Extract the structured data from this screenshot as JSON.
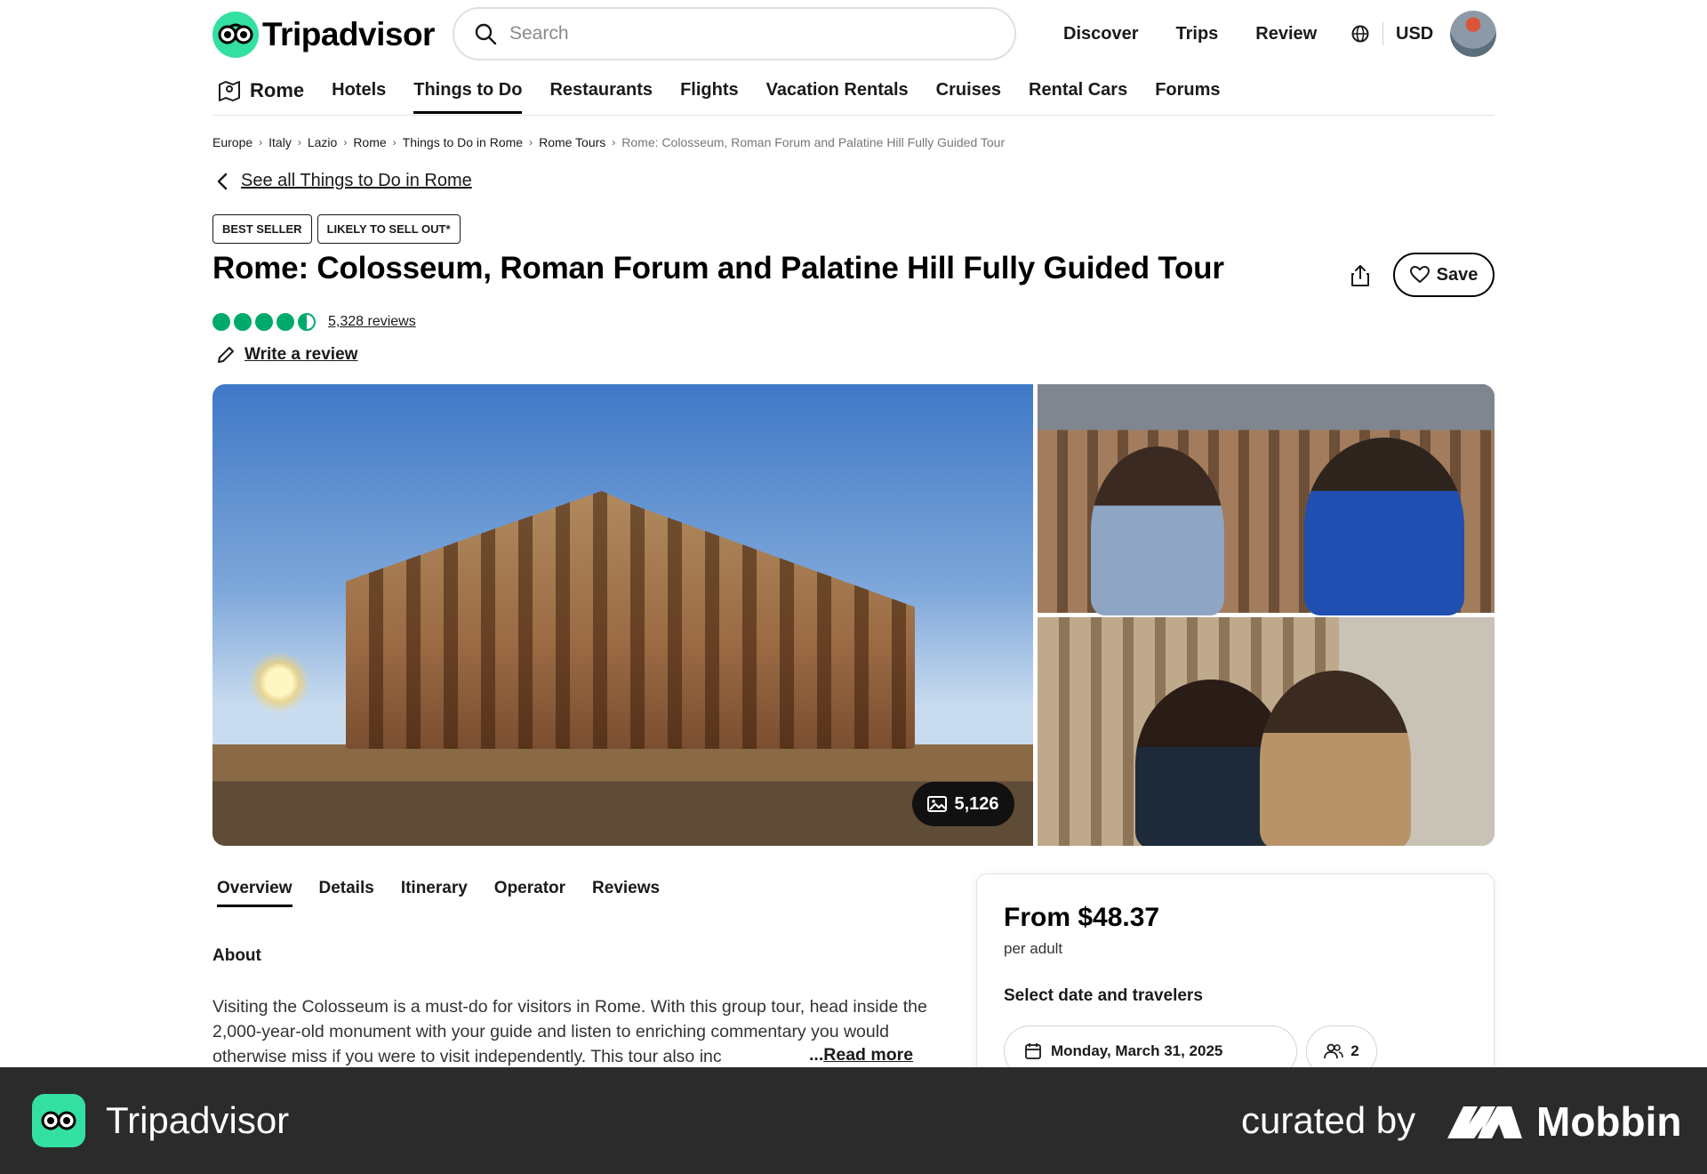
{
  "header": {
    "brand": "Tripadvisor",
    "search_placeholder": "Search",
    "nav": [
      "Discover",
      "Trips",
      "Review"
    ],
    "currency": "USD"
  },
  "subnav": {
    "home": "Rome",
    "items": [
      "Hotels",
      "Things to Do",
      "Restaurants",
      "Flights",
      "Vacation Rentals",
      "Cruises",
      "Rental Cars",
      "Forums"
    ],
    "active": "Things to Do"
  },
  "breadcrumb": [
    "Europe",
    "Italy",
    "Lazio",
    "Rome",
    "Things to Do in Rome",
    "Rome Tours",
    "Rome: Colosseum, Roman Forum and Palatine Hill Fully Guided Tour"
  ],
  "back_link": "See all Things to Do in Rome",
  "badges": [
    "BEST SELLER",
    "LIKELY TO SELL OUT*"
  ],
  "title": "Rome: Colosseum, Roman Forum and Palatine Hill Fully Guided Tour",
  "save_label": "Save",
  "rating": {
    "value": 4.5,
    "max": 5,
    "reviews": "5,328 reviews"
  },
  "write_review": "Write a review",
  "photo_count": "5,126",
  "tabs": [
    "Overview",
    "Details",
    "Itinerary",
    "Operator",
    "Reviews"
  ],
  "active_tab": "Overview",
  "about": {
    "heading": "About",
    "text": "Visiting the Colosseum is a must-do for visitors in Rome. With this group tour, head inside the 2,000-year-old monument with your guide and listen to enriching commentary you would otherwise miss if you were to visit independently. This tour also inc",
    "read_more_prefix": "...",
    "read_more": "Read more"
  },
  "booking": {
    "price": "From $48.37",
    "per": "per adult",
    "select_heading": "Select date and travelers",
    "date": "Monday, March 31, 2025",
    "travelers": "2"
  },
  "footer": {
    "app_name": "Tripadvisor",
    "curated_by": "curated by",
    "brand": "Mobbin"
  },
  "colors": {
    "brand_green": "#34e0a1",
    "rating_green": "#00aa6c",
    "footer_bg": "#2b2b2b"
  }
}
